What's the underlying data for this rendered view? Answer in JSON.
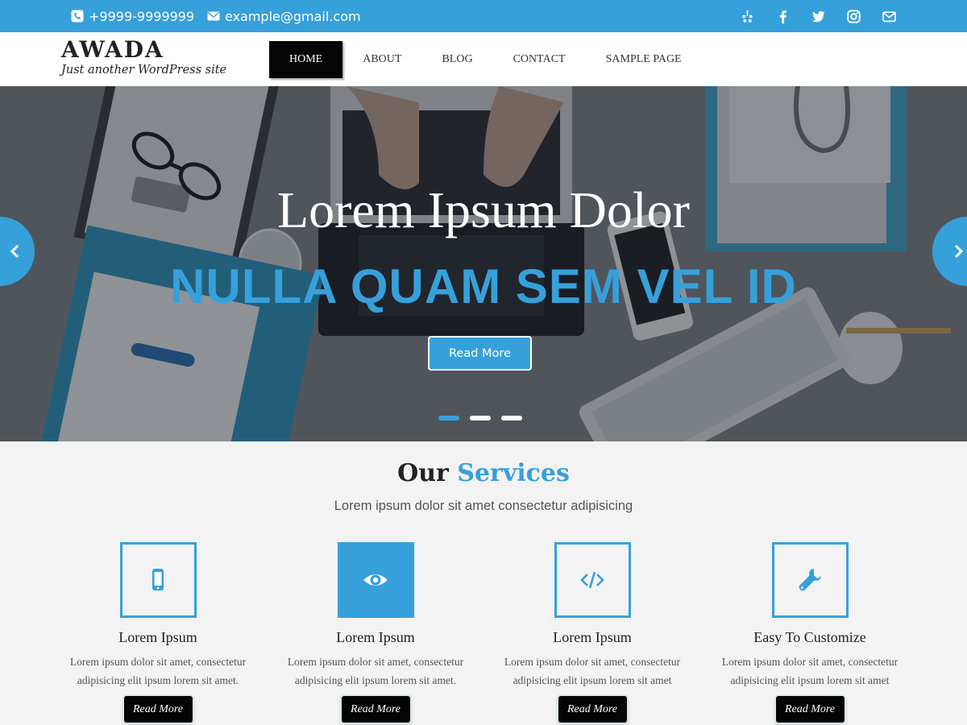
{
  "topbar": {
    "phone": "+9999-9999999",
    "email": "example@gmail.com",
    "socials": [
      "yelp-icon",
      "facebook-icon",
      "twitter-icon",
      "instagram-icon",
      "mail-icon"
    ]
  },
  "header": {
    "site_name": "AWADA",
    "tagline": "Just another WordPress site",
    "nav": [
      "HOME",
      "ABOUT",
      "BLOG",
      "CONTACT",
      "SAMPLE PAGE"
    ]
  },
  "hero": {
    "title": "Lorem Ipsum Dolor",
    "subtitle": "NULLA QUAM SEM VEL ID",
    "button": "Read More",
    "slide_count": 3,
    "active_slide": 1
  },
  "services": {
    "heading_part1": "Our",
    "heading_part2": "Services",
    "subtitle": "Lorem ipsum dolor sit amet consectetur adipisicing",
    "items": [
      {
        "icon": "mobile-icon",
        "title": "Lorem Ipsum",
        "text_line1": "Lorem ipsum dolor sit amet, consectetur",
        "text_line2": "adipisicing elit ipsum lorem sit amet.",
        "button": "Read More"
      },
      {
        "icon": "eye-icon",
        "title": "Lorem Ipsum",
        "text_line1": "Lorem ipsum dolor sit amet, consectetur",
        "text_line2": "adipisicing elit ipsum lorem sit amet.",
        "button": "Read More"
      },
      {
        "icon": "code-icon",
        "title": "Lorem Ipsum",
        "text_line1": "Lorem ipsum dolor sit amet, consectetur",
        "text_line2": "adipisicing elit ipsum lorem sit amet",
        "button": "Read More"
      },
      {
        "icon": "wrench-icon",
        "title": "Easy To Customize",
        "text_line1": "Lorem ipsum dolor sit amet, consectetur",
        "text_line2": "adipisicing elit ipsum lorem sit amet",
        "button": "Read More"
      }
    ]
  },
  "colors": {
    "accent": "#36a0db",
    "dark": "#050505",
    "section_bg": "#f3f3f3"
  }
}
